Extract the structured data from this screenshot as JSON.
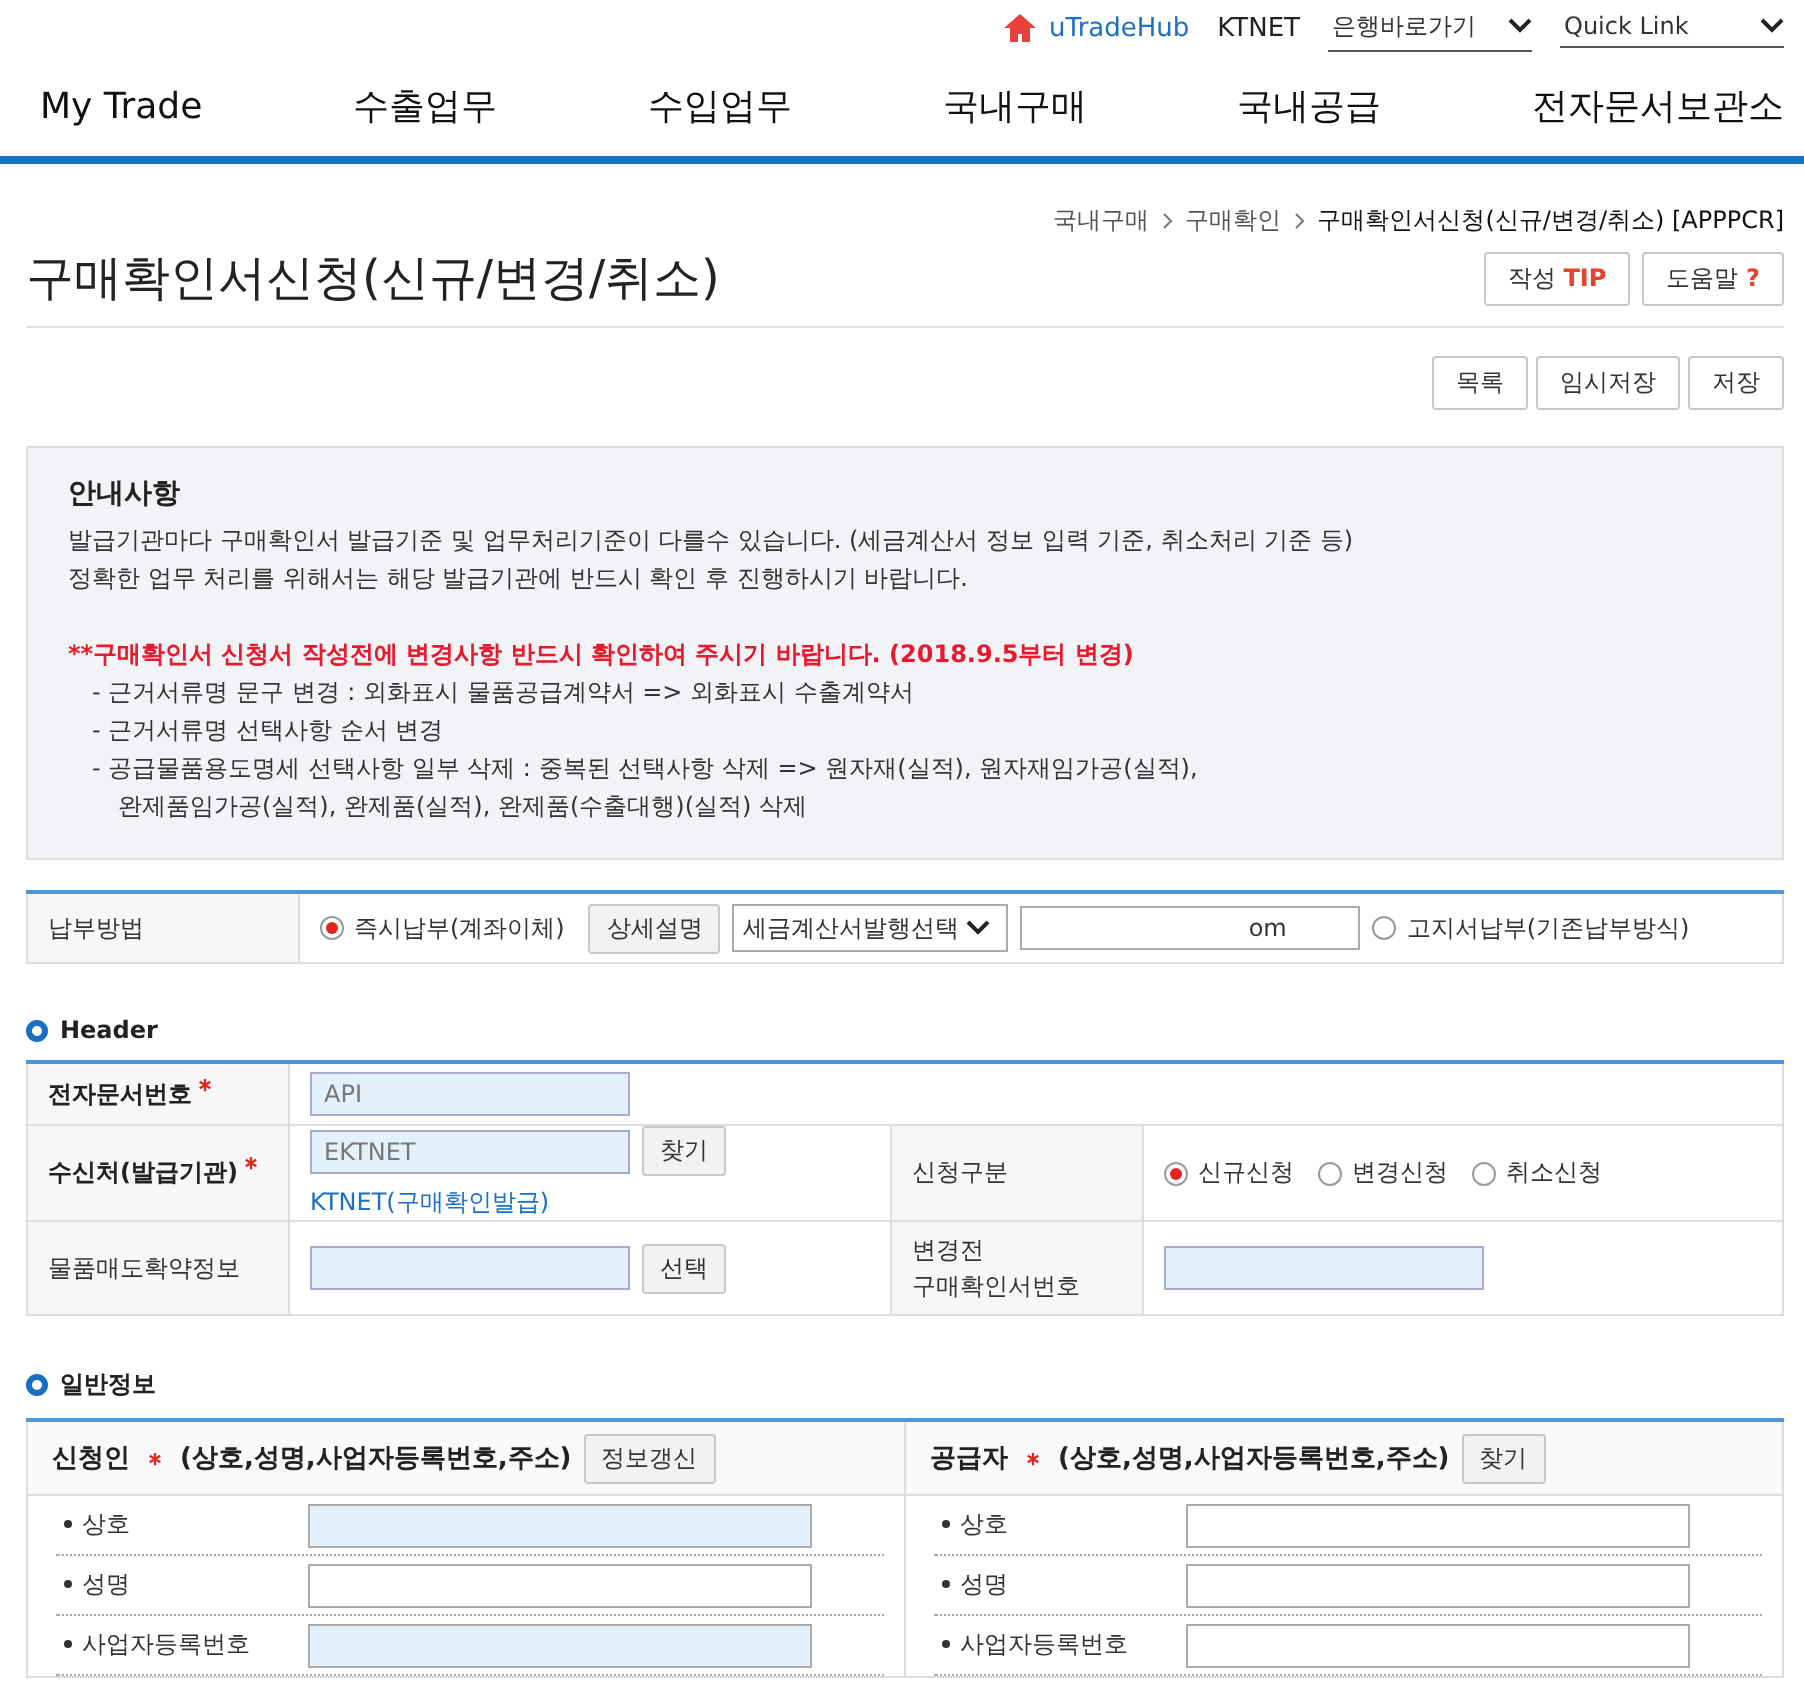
{
  "top_links": {
    "home": "uTradeHub",
    "company": "KTNET",
    "dropdowns": [
      "은행바로가기",
      "Quick Link"
    ]
  },
  "nav": [
    "My Trade",
    "수출업무",
    "수입업무",
    "국내구매",
    "국내공급",
    "전자문서보관소"
  ],
  "breadcrumb": [
    "국내구매",
    "구매확인",
    "구매확인서신청(신규/변경/취소) [APPPCR]"
  ],
  "page_title": "구매확인서신청(신규/변경/취소)",
  "title_buttons": [
    {
      "label": "작성",
      "accent": "TIP"
    },
    {
      "label": "도움말",
      "accent": "?"
    }
  ],
  "actions": [
    "목록",
    "임시저장",
    "저장"
  ],
  "notice": {
    "title": "안내사항",
    "lines": [
      "발급기관마다 구매확인서 발급기준 및 업무처리기준이 다를수 있습니다. (세금계산서 정보 입력 기준, 취소처리 기준 등)",
      "정확한 업무 처리를 위해서는 해당 발급기관에 반드시 확인 후 진행하시기 바랍니다."
    ],
    "warning": "**구매확인서 신청서 작성전에 변경사항 반드시 확인하여 주시기 바랍니다. (2018.9.5부터 변경)",
    "bullets": [
      "- 근거서류명 문구 변경 : 외화표시 물품공급계약서 => 외화표시 수출계약서",
      "- 근거서류명 선택사항 순서 변경",
      "- 공급물품용도명세 선택사항 일부 삭제 : 중복된 선택사항 삭제 => 원자재(실적), 원자재임가공(실적),",
      "완제품임가공(실적), 완제품(실적), 완제품(수출대행)(실적) 삭제"
    ]
  },
  "payment": {
    "label": "납부방법",
    "options": [
      {
        "label": "즉시납부(계좌이체)",
        "selected": true
      },
      {
        "label": "고지서납부(기존납부방식)",
        "selected": false
      }
    ],
    "detail_button": "상세설명",
    "select": "세금계산서발행선택",
    "email": "om"
  },
  "header": {
    "title": "Header",
    "doc_no": {
      "label": "전자문서번호",
      "value": "API"
    },
    "receiver": {
      "label": "수신처(발급기관)",
      "value": "EKTNET",
      "button": "찾기",
      "link": "KTNET(구매확인발급)"
    },
    "request_type": {
      "label": "신청구분",
      "options": [
        {
          "label": "신규신청",
          "selected": true
        },
        {
          "label": "변경신청",
          "selected": false
        },
        {
          "label": "취소신청",
          "selected": false
        }
      ]
    },
    "contract": {
      "label": "물품매도확약정보",
      "button": "선택"
    },
    "prev_no": {
      "label": "변경전\n구매확인서번호"
    }
  },
  "general": {
    "title": "일반정보",
    "panels": [
      {
        "title": "신청인",
        "detail": "(상호,성명,사업자등록번호,주소)",
        "button": "정보갱신",
        "fields": [
          {
            "label": "상호",
            "filled": true
          },
          {
            "label": "성명",
            "filled": false
          },
          {
            "label": "사업자등록번호",
            "filled": true
          }
        ]
      },
      {
        "title": "공급자",
        "detail": "(상호,성명,사업자등록번호,주소)",
        "button": "찾기",
        "fields": [
          {
            "label": "상호",
            "filled": false
          },
          {
            "label": "성명",
            "filled": false
          },
          {
            "label": "사업자등록번호",
            "filled": false
          }
        ]
      }
    ]
  }
}
